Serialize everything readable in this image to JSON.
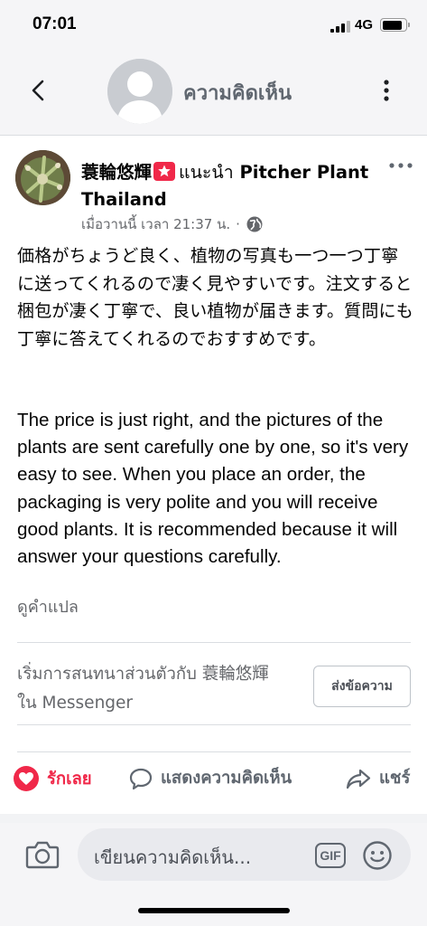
{
  "status": {
    "time": "07:01",
    "network": "4G",
    "battery_level": 0.9
  },
  "header": {
    "title": "ความคิดเห็น",
    "back_icon": "chevron-left-icon",
    "more_icon": "vertical-dots-icon"
  },
  "post": {
    "author": "蓑輪悠輝",
    "recommends_label": "แนะนำ",
    "page_name": "Pitcher Plant Thailand",
    "timestamp": "เมื่อวานนี้ เวลา 21:37 น.",
    "separator": "·",
    "text_jp": "価格がちょうど良く、植物の写真も一つ一つ丁寧に送ってくれるので凄く見やすいです。注文すると梱包が凄く丁寧で、良い植物が届きます。質問にも丁寧に答えてくれるのでおすすめです。",
    "text_en": "The price is just right, and the pictures of the plants are sent carefully one by one, so it's very easy to see.  When you place an order, the packaging is very polite and you will receive good plants. It is recommended because it will answer your questions carefully.",
    "translate_label": "ดูคำแปล"
  },
  "messenger": {
    "prompt": "เริ่มการสนทนาส่วนตัวกับ 蓑輪悠輝 ใน Messenger",
    "send_button": "ส่งข้อความ"
  },
  "actions": {
    "like": "รักเลย",
    "comment": "แสดงความคิดเห็น",
    "share": "แชร์"
  },
  "composer": {
    "placeholder": "เขียนความคิดเห็น...",
    "gif_label": "GIF"
  },
  "colors": {
    "love_red": "#f02849",
    "secondary_text": "#65676b",
    "background_gray": "#f5f5f7"
  }
}
